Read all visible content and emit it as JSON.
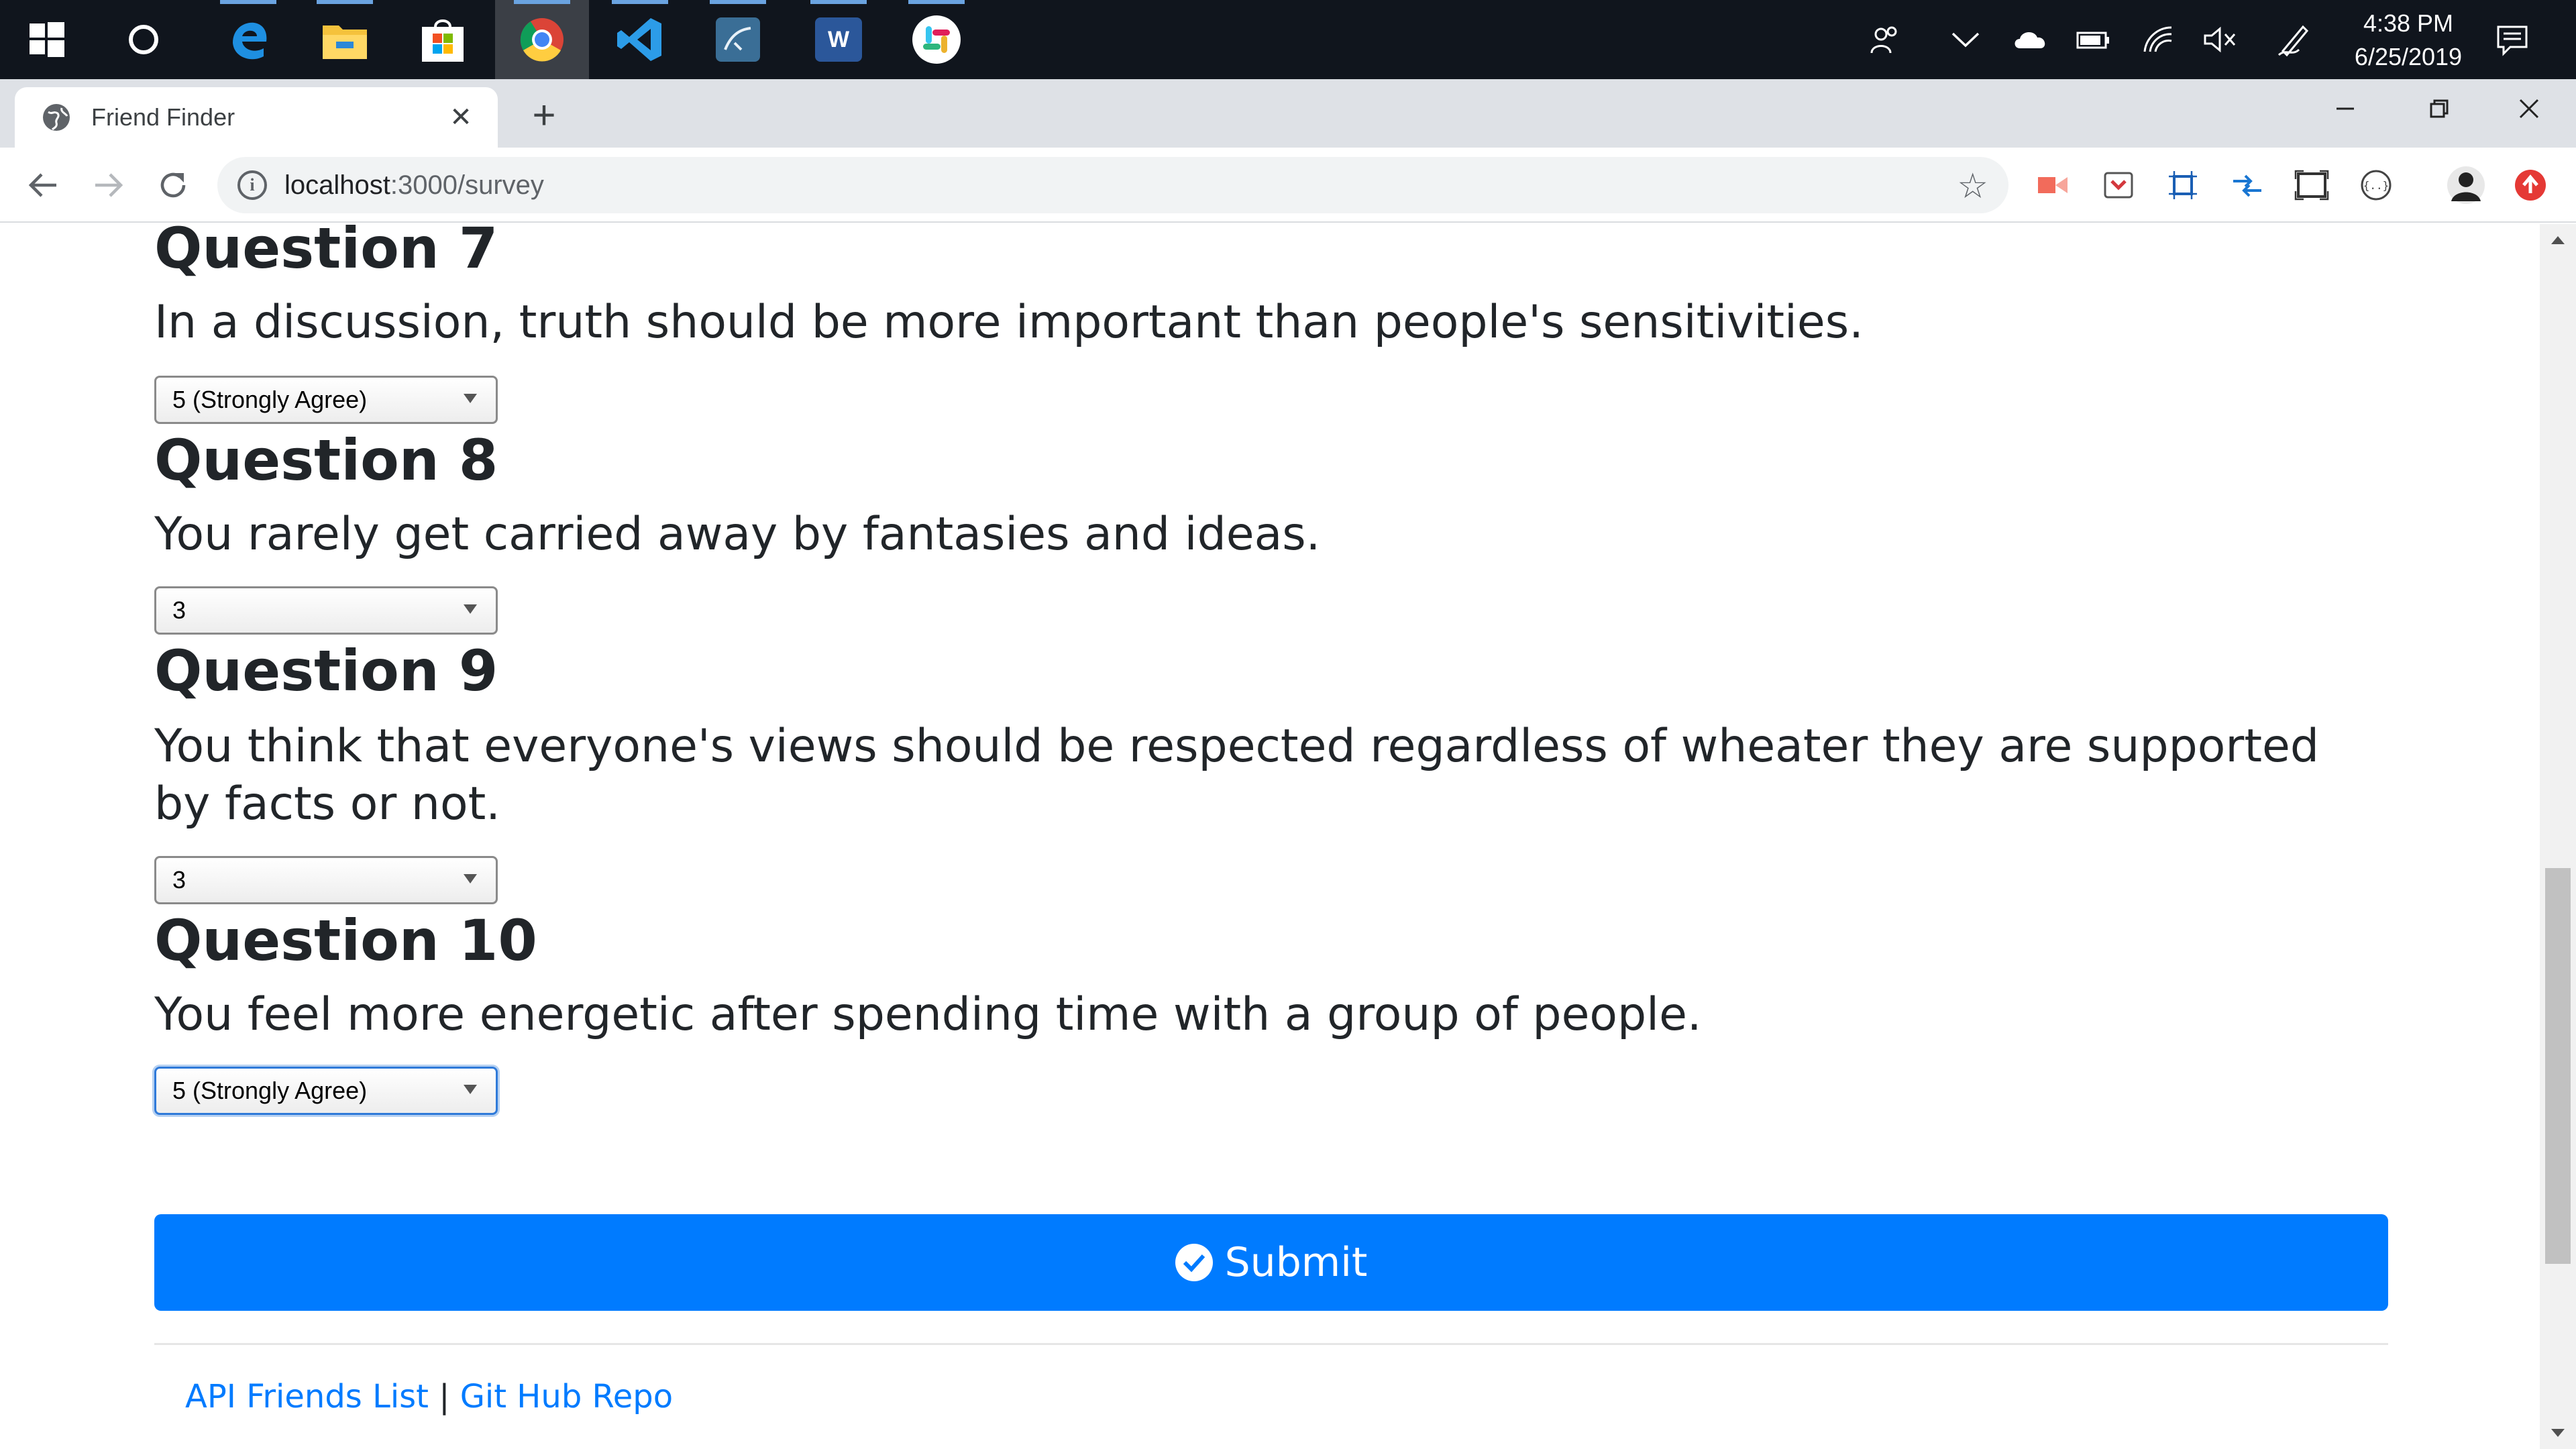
{
  "taskbar": {
    "apps": [
      {
        "name": "windows-start-icon"
      },
      {
        "name": "cortana-icon"
      },
      {
        "name": "edge-icon"
      },
      {
        "name": "file-explorer-icon"
      },
      {
        "name": "microsoft-store-icon"
      },
      {
        "name": "chrome-icon"
      },
      {
        "name": "vscode-icon"
      },
      {
        "name": "mysql-workbench-icon"
      },
      {
        "name": "word-icon"
      },
      {
        "name": "slack-icon"
      }
    ],
    "time": "4:38 PM",
    "date": "6/25/2019"
  },
  "browser": {
    "tab_title": "Friend Finder",
    "url_host": "localhost",
    "url_path": ":3000/survey"
  },
  "survey": {
    "questions": [
      {
        "title": "Question 7",
        "text": "In a discussion, truth should be more important than people's sensitivities.",
        "selected": "5 (Strongly Agree)"
      },
      {
        "title": "Question 8",
        "text": "You rarely get carried away by fantasies and ideas.",
        "selected": "3"
      },
      {
        "title": "Question 9",
        "text": "You think that everyone's views should be respected regardless of wheater they are supported by facts or not.",
        "selected": "3"
      },
      {
        "title": "Question 10",
        "text": "You feel more energetic after spending time with a group of people.",
        "selected": "5 (Strongly Agree)"
      }
    ],
    "submit_label": "Submit"
  },
  "footer": {
    "link1": "API Friends List",
    "separator": "|",
    "link2": "Git Hub Repo"
  },
  "colors": {
    "primary": "#007bff",
    "taskbar": "#10151d",
    "tabstrip": "#dee1e6"
  }
}
